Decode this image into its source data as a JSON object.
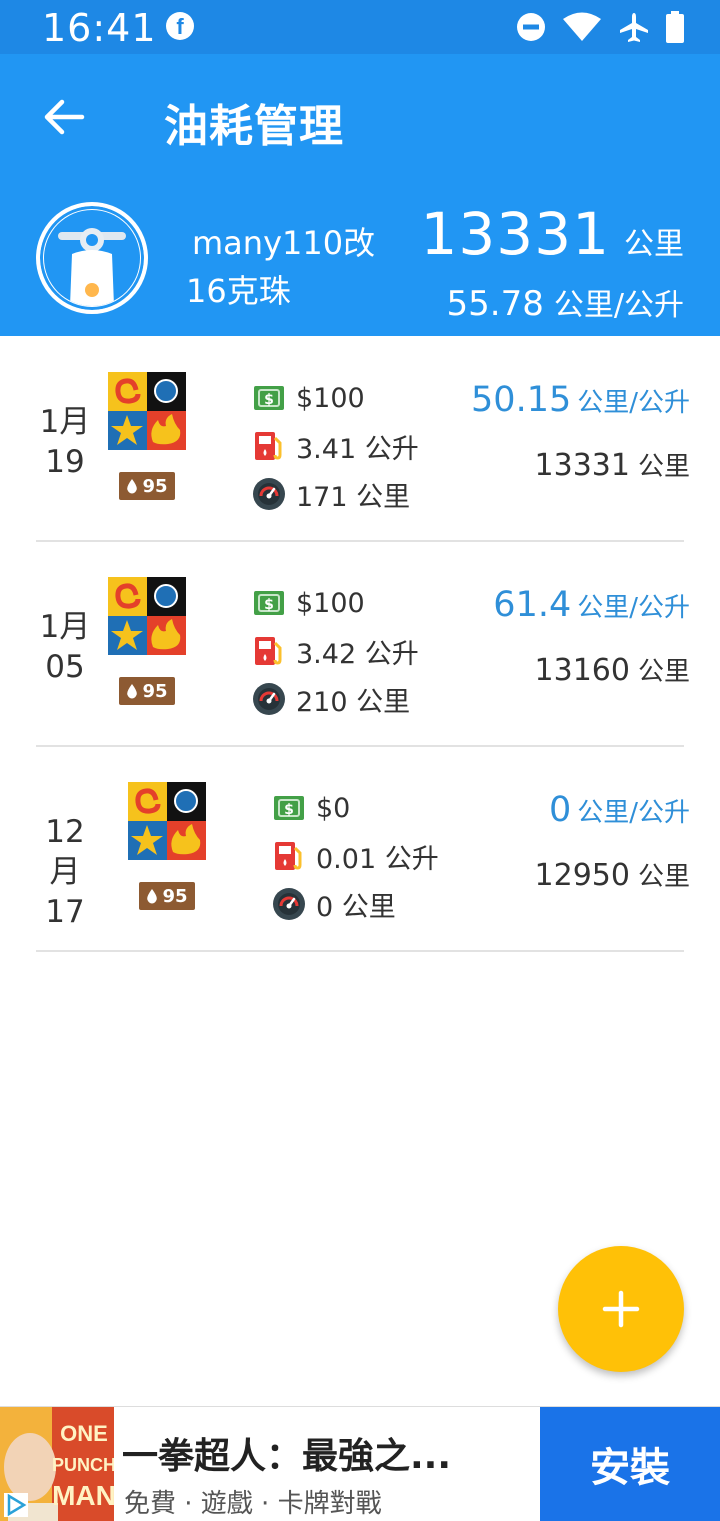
{
  "status_bar": {
    "time": "16:41",
    "fb_glyph": "f"
  },
  "header": {
    "title": "油耗管理",
    "vehicle_name": "many110改",
    "fuel_category": "16克珠",
    "total_km": "13331",
    "total_km_unit": "公里",
    "avg_efficiency": "55.78",
    "avg_efficiency_unit": "公里/公升"
  },
  "records": [
    {
      "month": "1月",
      "day": "19",
      "grade": "95",
      "cost": "$100",
      "liters": "3.41 公升",
      "distance": "171 公里",
      "efficiency": "50.15",
      "efficiency_unit": "公里/公升",
      "odometer": "13331",
      "odometer_unit": "公里"
    },
    {
      "month": "1月",
      "day": "05",
      "grade": "95",
      "cost": "$100",
      "liters": "3.42 公升",
      "distance": "210 公里",
      "efficiency": "61.4",
      "efficiency_unit": "公里/公升",
      "odometer": "13160",
      "odometer_unit": "公里"
    },
    {
      "month": "12月",
      "day": "17",
      "grade": "95",
      "cost": "$0",
      "liters": "0.01 公升",
      "distance": "0 公里",
      "efficiency": "0",
      "efficiency_unit": "公里/公升",
      "odometer": "12950",
      "odometer_unit": "公里"
    }
  ],
  "ad": {
    "title": "一拳超人：最強之...",
    "subtitle": "免費 · 遊戲 · 卡牌對戰",
    "install_label": "安裝",
    "image_text": "ONE PUNCH MAN"
  },
  "colors": {
    "primary": "#2196f3",
    "status_bar": "#1e88e5",
    "accent": "#ffc107",
    "efficiency_text": "#2f8fd8",
    "grade_badge": "#8d5a32"
  }
}
